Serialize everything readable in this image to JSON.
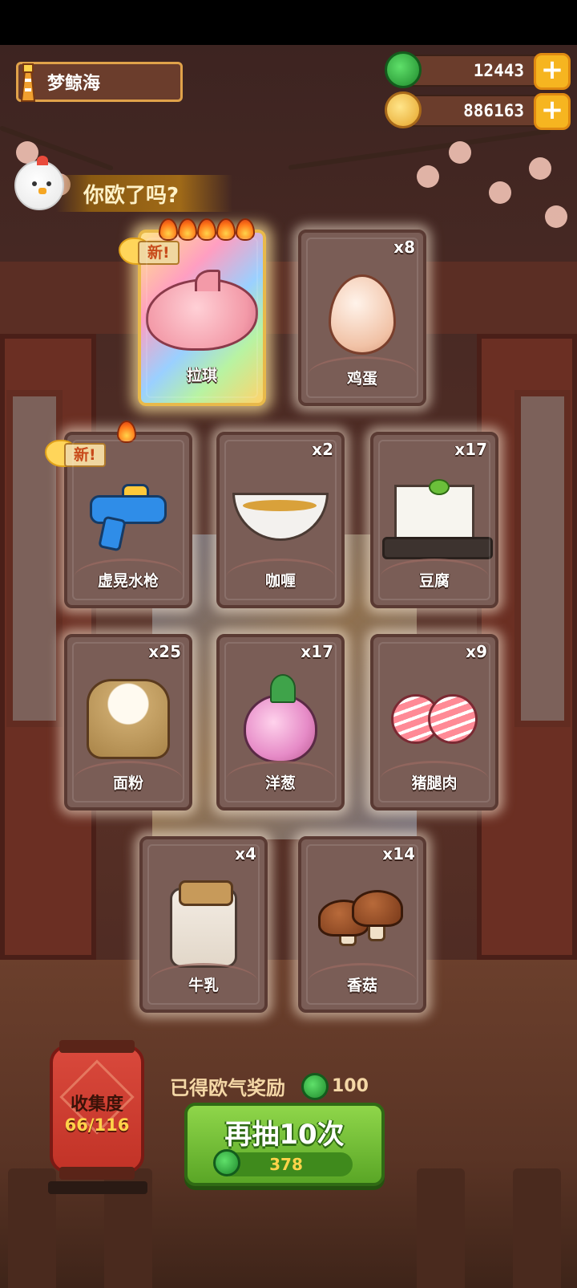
{
  "header": {
    "location": "梦鲸海",
    "gems": "12443",
    "coins": "886163",
    "banner": "你欧了吗?"
  },
  "cards": [
    {
      "name": "拉琪",
      "qty": "",
      "new_label": "新!",
      "stars": 5,
      "icon": "pink-dolphin"
    },
    {
      "name": "鸡蛋",
      "qty": "x8",
      "icon": "egg"
    },
    {
      "name": "虚晃水枪",
      "qty": "",
      "new_label": "新!",
      "stars": 1,
      "icon": "water-gun"
    },
    {
      "name": "咖喱",
      "qty": "x2",
      "icon": "curry-gravy-boat"
    },
    {
      "name": "豆腐",
      "qty": "x17",
      "icon": "tofu"
    },
    {
      "name": "面粉",
      "qty": "x25",
      "icon": "flour-sack"
    },
    {
      "name": "洋葱",
      "qty": "x17",
      "icon": "onion"
    },
    {
      "name": "猪腿肉",
      "qty": "x9",
      "icon": "ham-slices"
    },
    {
      "name": "牛乳",
      "qty": "x4",
      "icon": "milk-jar"
    },
    {
      "name": "香菇",
      "qty": "x14",
      "icon": "shiitake"
    }
  ],
  "collection": {
    "label": "收集度",
    "value": "66/116"
  },
  "reward": {
    "label": "已得欧气奖励",
    "value": "100"
  },
  "draw_button": {
    "label": "再抽10次",
    "cost": "378"
  },
  "colors": {
    "accent_green": "#5aa626",
    "gold": "#f6b520",
    "card_bg": "#7a5d56"
  }
}
